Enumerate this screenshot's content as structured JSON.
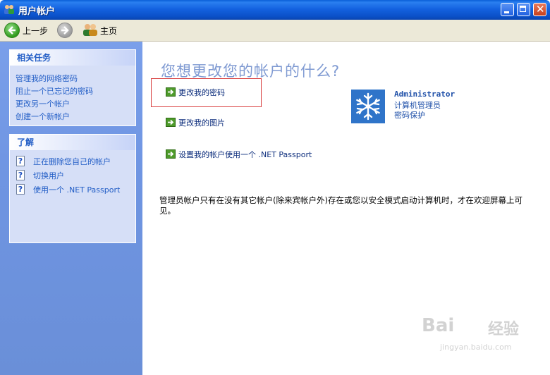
{
  "window": {
    "title": "用户帐户",
    "icon": "user-accounts-icon",
    "accent_color": "#0a5fd8"
  },
  "toolbar": {
    "back_label": "上一步",
    "home_label": "主页"
  },
  "sidebar": {
    "related_tasks": {
      "title": "相关任务",
      "items": [
        "管理我的网络密码",
        "阻止一个已忘记的密码",
        "更改另一个帐户",
        "创建一个新帐户"
      ]
    },
    "learn": {
      "title": "了解",
      "items": [
        "正在删除您自己的帐户",
        "切换用户",
        "使用一个 .NET Passport"
      ]
    }
  },
  "main": {
    "heading": "您想更改您的帐户的什么?",
    "options": [
      "更改我的密码",
      "更改我的图片",
      "设置我的帐户使用一个 .NET Passport"
    ],
    "account": {
      "name": "Administrator",
      "role": "计算机管理员",
      "status": "密码保护"
    },
    "note": "管理员帐户只有在没有其它帐户(除来宾帐户外)存在或您以安全模式启动计算机时，才在欢迎屏幕上可见。"
  },
  "watermark": {
    "logo": "Bai",
    "text": "经验",
    "url": "jingyan.baidu.com"
  }
}
